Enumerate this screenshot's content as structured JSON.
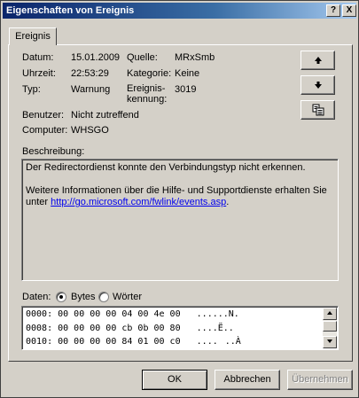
{
  "window": {
    "title": "Eigenschaften von Ereignis"
  },
  "titlebar_buttons": {
    "help": "?",
    "close": "X"
  },
  "tab": {
    "label": "Ereignis"
  },
  "fields": {
    "datum_label": "Datum:",
    "datum_value": "15.01.2009",
    "uhrzeit_label": "Uhrzeit:",
    "uhrzeit_value": "22:53:29",
    "typ_label": "Typ:",
    "typ_value": "Warnung",
    "benutzer_label": "Benutzer:",
    "benutzer_value": "Nicht zutreffend",
    "computer_label": "Computer:",
    "computer_value": "WHSGO",
    "quelle_label": "Quelle:",
    "quelle_value": "MRxSmb",
    "kategorie_label": "Kategorie:",
    "kategorie_value": "Keine",
    "kennung_label_line1": "Ereignis-",
    "kennung_label_line2": "kennung:",
    "kennung_value": "3019"
  },
  "description": {
    "label": "Beschreibung:",
    "line1": "Der Redirectordienst konnte den Verbindungstyp nicht erkennen.",
    "line2": "Weitere Informationen über die Hilfe- und Supportdienste erhalten Sie",
    "line3_prefix": "unter ",
    "link": "http://go.microsoft.com/fwlink/events.asp",
    "line3_suffix": "."
  },
  "data_section": {
    "label": "Daten:",
    "option_bytes": "Bytes",
    "option_words": "Wörter",
    "selected": "Bytes",
    "rows": [
      "0000: 00 00 00 00 04 00 4e 00   ......N.",
      "0008: 00 00 00 00 cb 0b 00 80   ....Ë..",
      "0010: 00 00 00 00 84 01 00 c0   ......À"
    ]
  },
  "buttons": {
    "ok": "OK",
    "cancel": "Abbrechen",
    "apply": "Übernehmen"
  },
  "icons": {
    "up": "arrow-up-icon",
    "down": "arrow-down-icon",
    "copy": "copy-icon"
  }
}
